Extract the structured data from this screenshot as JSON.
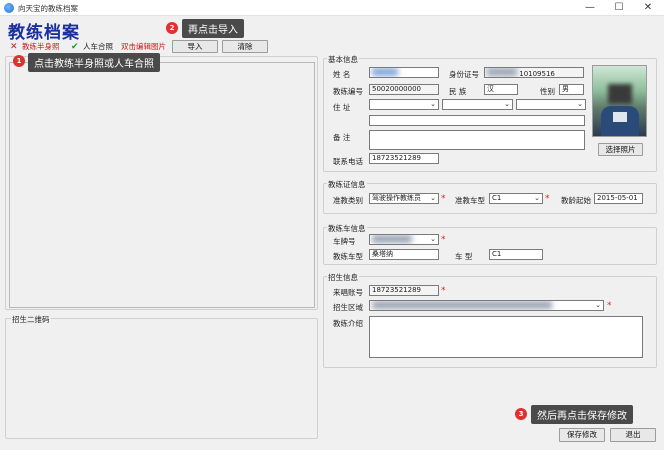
{
  "window": {
    "title": "向天宝的教练档案",
    "minimize": "—",
    "maximize": "☐",
    "close": "✕"
  },
  "page_title": "教练档案",
  "toolbar": {
    "half_photo_label": "教练半身照",
    "car_photo_label": "人车合照",
    "dblclick_hint": "双击编辑图片",
    "import_label": "导入",
    "clear_label": "清除"
  },
  "photo_panel_title": "",
  "qr_panel_title": "招生二维码",
  "basic": {
    "title": "基本信息",
    "name_label": "姓  名",
    "name_value": "",
    "idcard_label": "身份证号",
    "idcard_value": "10109516",
    "coach_no_label": "教练编号",
    "coach_no_value": "50020000000",
    "ethnic_label": "民  族",
    "ethnic_value": "汉",
    "gender_label": "性别",
    "gender_value": "男",
    "address_label": "住  址",
    "remark_label": "备  注",
    "phone_label": "联系电话",
    "phone_value": "18723521289",
    "select_photo_label": "选择照片"
  },
  "license": {
    "title": "教练证信息",
    "type_label": "准教类别",
    "type_value": "驾驶操作教练员",
    "car_type_label": "准教车型",
    "car_type_value": "C1",
    "since_label": "教龄起始",
    "since_value": "2015-05-01"
  },
  "car": {
    "title": "教练车信息",
    "plate_label": "车牌号",
    "model_label": "教练车型",
    "model_value": "桑塔纳",
    "type_label": "车  型",
    "type_value": "C1"
  },
  "recruit": {
    "title": "招生信息",
    "account_label": "来唱账号",
    "account_value": "18723521289",
    "area_label": "招生区域",
    "intro_label": "教练介绍"
  },
  "footer": {
    "save_label": "保存修改",
    "exit_label": "退出"
  },
  "callouts": {
    "c1": {
      "num": "1",
      "text": "点击教练半身照或人车合照"
    },
    "c2": {
      "num": "2",
      "text": "再点击导入"
    },
    "c3": {
      "num": "3",
      "text": "然后再点击保存修改"
    }
  },
  "colors": {
    "title_blue": "#1a2fa0",
    "required": "#d22222",
    "callout_bg": "#4a4a4a",
    "badge": "#e03030"
  }
}
